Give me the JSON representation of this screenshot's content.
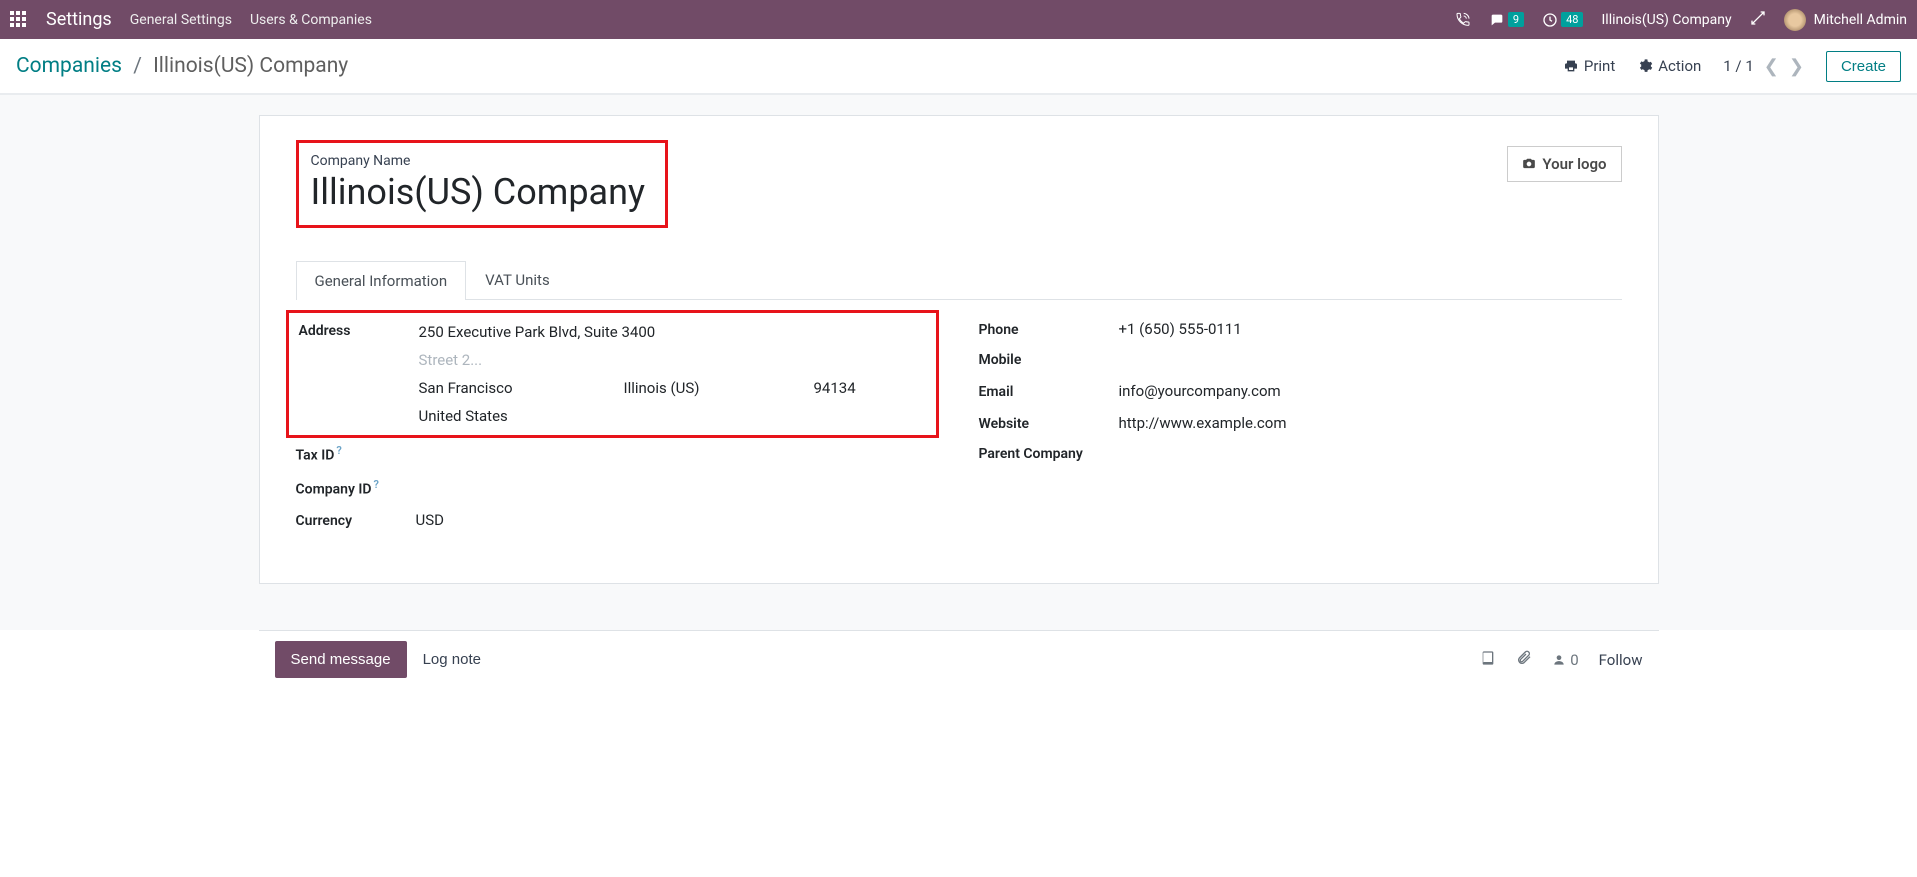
{
  "topbar": {
    "app_title": "Settings",
    "nav": [
      "General Settings",
      "Users & Companies"
    ],
    "messages_badge": "9",
    "activities_badge": "48",
    "company": "Illinois(US) Company",
    "user": "Mitchell Admin"
  },
  "breadcrumb": {
    "root": "Companies",
    "current": "Illinois(US) Company"
  },
  "controls": {
    "print": "Print",
    "action": "Action",
    "pager": "1 / 1",
    "create": "Create"
  },
  "sheet": {
    "company_name_label": "Company Name",
    "company_name": "Illinois(US) Company",
    "logo_label": "Your logo",
    "tabs": [
      "General Information",
      "VAT Units"
    ],
    "fields_left": {
      "address_label": "Address",
      "street": "250 Executive Park Blvd, Suite 3400",
      "street2_placeholder": "Street 2...",
      "city": "San Francisco",
      "state": "Illinois (US)",
      "zip": "94134",
      "country": "United States",
      "tax_id_label": "Tax ID",
      "company_id_label": "Company ID",
      "currency_label": "Currency",
      "currency": "USD"
    },
    "fields_right": {
      "phone_label": "Phone",
      "phone": "+1 (650) 555-0111",
      "mobile_label": "Mobile",
      "email_label": "Email",
      "email": "info@yourcompany.com",
      "website_label": "Website",
      "website": "http://www.example.com",
      "parent_label": "Parent Company"
    }
  },
  "chatter": {
    "send_message": "Send message",
    "log_note": "Log note",
    "follower_count": "0",
    "follow": "Follow"
  }
}
